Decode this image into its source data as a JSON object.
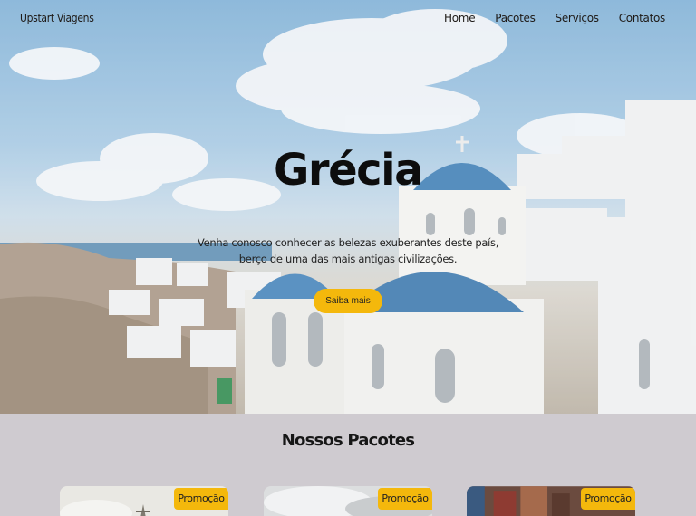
{
  "navbar": {
    "brand": "Upstart Viagens",
    "links": [
      {
        "label": "Home"
      },
      {
        "label": "Pacotes"
      },
      {
        "label": "Serviços"
      },
      {
        "label": "Contatos"
      }
    ]
  },
  "hero": {
    "title": "Grécia",
    "description_line1": "Venha conosco conhecer as belezas exuberantes deste país,",
    "description_line2": "berço de uma das mais antigas civilizações.",
    "button_label": "Saiba mais"
  },
  "packages": {
    "title": "Nossos Pacotes",
    "cards": [
      {
        "badge": "Promoção"
      },
      {
        "badge": "Promoção"
      },
      {
        "badge": "Promoção"
      }
    ]
  },
  "colors": {
    "accent": "#f4b80c",
    "section_bg": "#cfcbd0",
    "text_dark": "#161616",
    "dome_blue": "#3f7fb5"
  }
}
